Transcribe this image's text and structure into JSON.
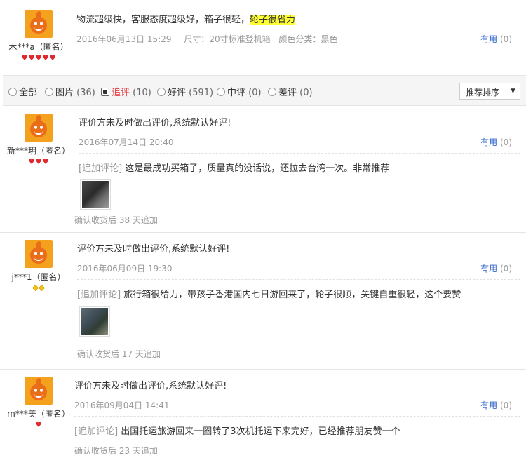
{
  "top_review": {
    "username": "木***a（匿名）",
    "badge_count": 5,
    "text_plain": "物流超级快，客服态度超级好，箱子很轻，",
    "text_highlight": "轮子很省力",
    "date": "2016年06月13日 15:29",
    "size_label": "尺寸：20寸标准登机箱",
    "color_label": "颜色分类：黑色",
    "useful_label": "有用",
    "useful_count": "(0)"
  },
  "filters": [
    {
      "label": "全部",
      "count": "",
      "checked": false
    },
    {
      "label": "图片",
      "count": "(36)",
      "checked": false
    },
    {
      "label": "追评",
      "count": "(10)",
      "checked": true
    },
    {
      "label": "好评",
      "count": "(591)",
      "checked": false
    },
    {
      "label": "中评",
      "count": "(0)",
      "checked": false
    },
    {
      "label": "差评",
      "count": "(0)",
      "checked": false
    }
  ],
  "sort_button": {
    "label": "推荐排序",
    "arrow": "▼"
  },
  "reviews": [
    {
      "username": "新***玥（匿名）",
      "badge": "heart",
      "text": "评价方未及时做出评价,系统默认好评!",
      "date": "2016年07月14日 20:40",
      "useful_label": "有用",
      "useful_count": "(0)",
      "add_tag": "[追加评论]",
      "add_text": "这是最成功买箱子，质量真的没话说，还拉去台湾一次。非常推荐",
      "confirm": "确认收货后 38 天追加"
    },
    {
      "username": "j***1（匿名）",
      "badge": "diamond",
      "text": "评价方未及时做出评价,系统默认好评!",
      "date": "2016年06月09日 19:30",
      "useful_label": "有用",
      "useful_count": "(0)",
      "add_tag": "[追加评论]",
      "add_text": "旅行箱很给力，带孩子香港国内七日游回来了，轮子很顺，关键自重很轻，这个要赞",
      "confirm": "确认收货后 17 天追加"
    },
    {
      "username": "m***美（匿名）",
      "badge": "heart",
      "text": "评价方未及时做出评价,系统默认好评!",
      "date": "2016年09月04日 14:41",
      "useful_label": "有用",
      "useful_count": "(0)",
      "add_tag": "[追加评论]",
      "add_text": "出国托运旅游回来一圈转了3次机托运下来完好，已经推荐朋友赞一个",
      "confirm": "确认收货后 23 天追加"
    }
  ],
  "colors": {
    "highlight": "#ffff33",
    "useful_link": "#3366cc",
    "active_filter": "#e4393c",
    "muted": "#999999"
  }
}
